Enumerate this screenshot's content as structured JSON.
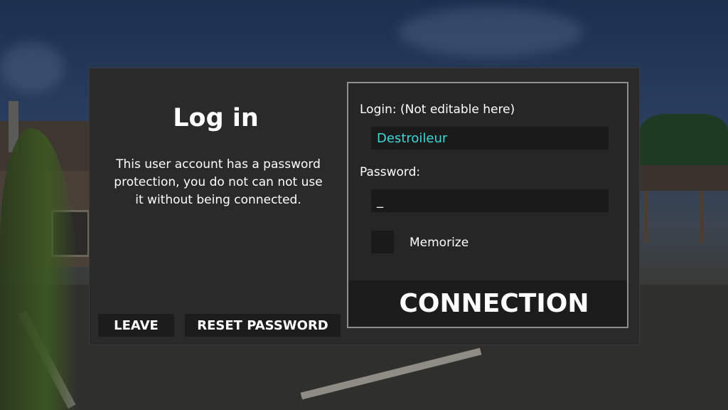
{
  "dialog": {
    "title": "Log in",
    "message": "This user account has a password protection, you do not can not use it without being connected.",
    "buttons": {
      "leave": "LEAVE",
      "reset_password": "RESET PASSWORD",
      "connection": "CONNECTION"
    },
    "form": {
      "login_label": "Login: (Not editable here)",
      "login_value": "Destroileur",
      "password_label": "Password:",
      "password_value": "_",
      "memorize_label": "Memorize",
      "memorize_checked": false
    }
  },
  "colors": {
    "login_value": "#3ed6d6",
    "panel_border": "#8e8e8e",
    "dialog_bg": "#2a2a2a"
  }
}
